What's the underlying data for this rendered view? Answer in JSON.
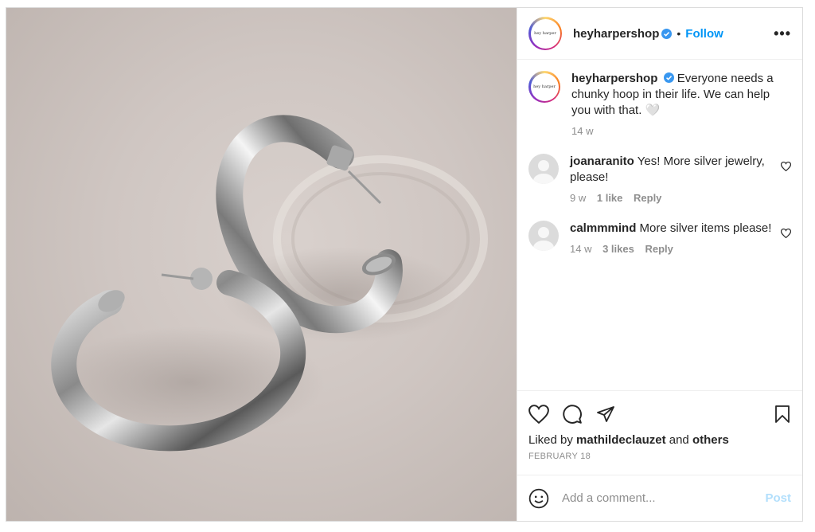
{
  "post": {
    "image_alt": "Silver chunky hoop earrings on sand",
    "account": {
      "username": "heyharpershop",
      "avatar_text": "hey harper",
      "verified": true
    },
    "header": {
      "dot": "•",
      "follow_label": "Follow",
      "more_label": "•••"
    },
    "caption": {
      "username": "heyharpershop",
      "text": "Everyone needs a chunky hoop in their life. We can help you with that. 🤍",
      "time": "14 w"
    },
    "comments": [
      {
        "username": "joanaranito",
        "text": "Yes! More silver jewelry, please!",
        "time": "9 w",
        "likes": "1 like",
        "reply": "Reply"
      },
      {
        "username": "calmmmind",
        "text": "More silver items please!",
        "time": "14 w",
        "likes": "3 likes",
        "reply": "Reply"
      }
    ],
    "likes": {
      "prefix": "Liked by",
      "user": "mathildeclauzet",
      "and": "and",
      "others": "others"
    },
    "date": "FEBRUARY 18",
    "add_comment": {
      "placeholder": "Add a comment...",
      "post_label": "Post"
    },
    "colors": {
      "follow": "#0095f6",
      "post_disabled": "#b2dffc",
      "verified": "#3897f0",
      "meta": "#8e8e8e"
    },
    "icons": [
      "heart-icon",
      "comment-icon",
      "share-icon",
      "bookmark-icon",
      "emoji-icon",
      "verified-icon",
      "more-icon"
    ]
  }
}
